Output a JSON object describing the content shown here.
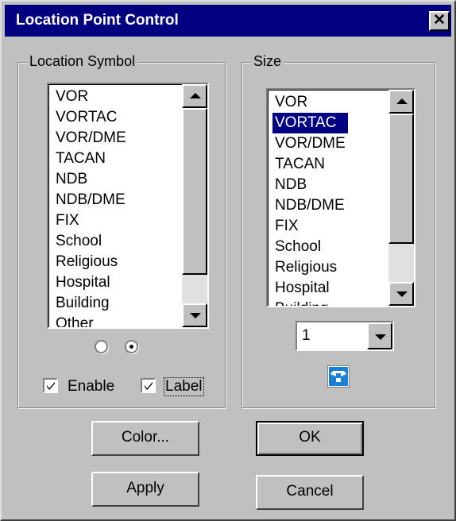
{
  "window": {
    "title": "Location Point Control",
    "close_label": "✕"
  },
  "location_symbol": {
    "group_label": "Location Symbol",
    "items": [
      "VOR",
      "VORTAC",
      "VOR/DME",
      "TACAN",
      "NDB",
      "NDB/DME",
      "FIX",
      "School",
      "Religious",
      "Hospital",
      "Building",
      "Other"
    ],
    "enable_label": "Enable",
    "label_label": "Label",
    "enable_checked": true,
    "label_checked": true
  },
  "size": {
    "group_label": "Size",
    "items": [
      "VOR",
      "VORTAC",
      "VOR/DME",
      "TACAN",
      "NDB",
      "NDB/DME",
      "FIX",
      "School",
      "Religious",
      "Hospital",
      "Building"
    ],
    "selected_item": "VORTAC",
    "combo_value": "1",
    "icon": "shape-preview-icon"
  },
  "buttons": {
    "color": "Color...",
    "ok": "OK",
    "apply": "Apply",
    "cancel": "Cancel"
  },
  "colors": {
    "title_bar": "#000080",
    "face": "#c0c0c0",
    "selection": "#000080",
    "icon_blue": "#0070c0"
  }
}
